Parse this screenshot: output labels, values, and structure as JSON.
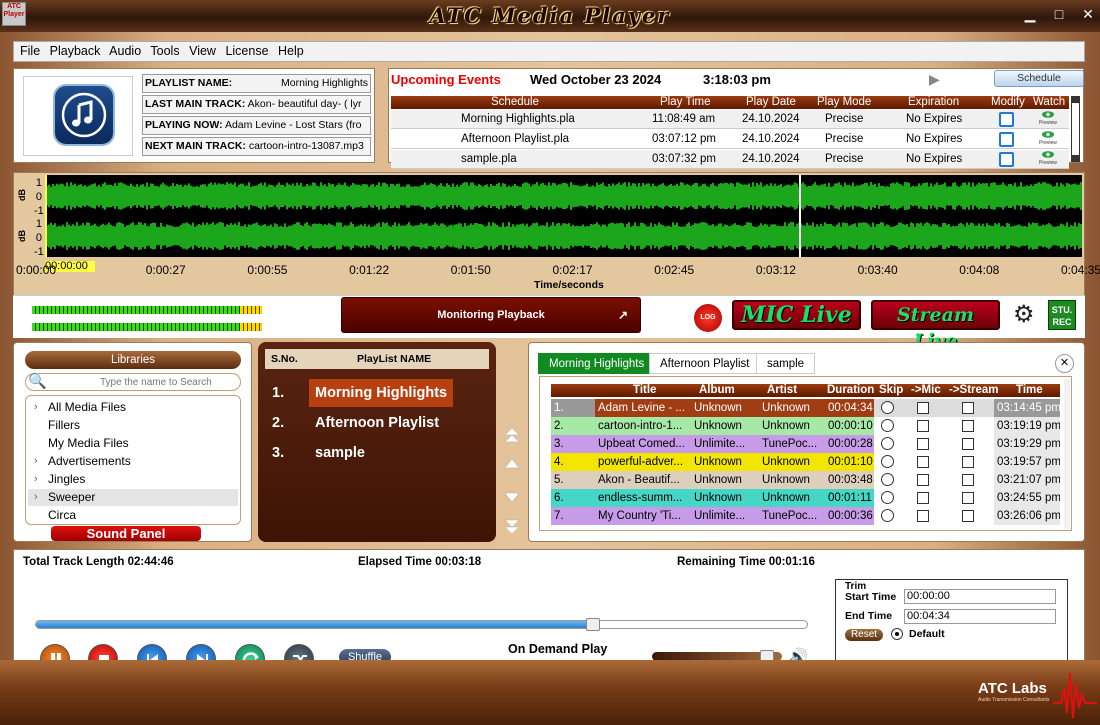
{
  "window": {
    "title": "ATC Media Player",
    "icon_label": "ATC Player"
  },
  "menu": [
    "File",
    "Playback",
    "Audio",
    "Tools",
    "View",
    "License",
    "Help"
  ],
  "now": {
    "playlist_label": "PLAYLIST NAME:",
    "playlist_value": "Morning Highlights",
    "last_label": "LAST MAIN TRACK:",
    "last_value": "Akon- beautiful day- ( lyr",
    "playing_label": "PLAYING NOW:",
    "playing_value": "Adam Levine - Lost Stars (fro",
    "next_label": "NEXT MAIN TRACK:",
    "next_value": "cartoon-intro-13087.mp3"
  },
  "events": {
    "heading": "Upcoming Events",
    "date": "Wed October 23 2024",
    "time": "3:18:03 pm",
    "schedule_button": "Schedule",
    "columns": [
      "Schedule",
      "Play Time",
      "Play Date",
      "Play Mode",
      "Expiration",
      "Modify",
      "Watch"
    ],
    "rows": [
      {
        "name": "Morning Highlights.pla",
        "time": "11:08:49 am",
        "date": "24.10.2024",
        "mode": "Precise",
        "exp": "No Expires"
      },
      {
        "name": "Afternoon Playlist.pla",
        "time": "03:07:12 pm",
        "date": "24.10.2024",
        "mode": "Precise",
        "exp": "No Expires"
      },
      {
        "name": "sample.pla",
        "time": "03:07:32 pm",
        "date": "24.10.2024",
        "mode": "Precise",
        "exp": "No Expires"
      }
    ],
    "preview_label": "Preview"
  },
  "wave": {
    "db_label": "dB",
    "ticks": [
      "0:00:00",
      "0:00:27",
      "0:00:55",
      "0:01:22",
      "0:01:50",
      "0:02:17",
      "0:02:45",
      "0:03:12",
      "0:03:40",
      "0:04:08",
      "0:04:35"
    ],
    "marker": "00:00:00",
    "xlabel": "Time/seconds",
    "y_ticks": [
      "1",
      "0",
      "-1"
    ]
  },
  "controls": {
    "monitoring": "Monitoring Playback",
    "log": "LOG",
    "mic_live": "MIC Live",
    "stream_live": "Stream Live",
    "stu_rec": "STU. REC"
  },
  "library": {
    "heading": "Libraries",
    "search_placeholder": "Type the name to Search",
    "items": [
      "All Media Files",
      "Fillers",
      "My Media Files",
      "Advertisements",
      "Jingles",
      "Sweeper",
      "Circa"
    ],
    "sound_panel": "Sound Panel"
  },
  "playlists": {
    "col_no": "S.No.",
    "col_name": "PlayList NAME",
    "items": [
      {
        "no": "1.",
        "name": "Morning Highlights"
      },
      {
        "no": "2.",
        "name": "Afternoon Playlist"
      },
      {
        "no": "3.",
        "name": "sample"
      }
    ]
  },
  "tracks": {
    "tabs": [
      "Morning Highlights",
      "Afternoon Playlist",
      "sample"
    ],
    "columns": [
      "Title",
      "Album",
      "Artist",
      "Duration",
      "Skip",
      "->Mic",
      "->Stream",
      "Time"
    ],
    "rows": [
      {
        "no": "1.",
        "title": "Adam Levine - ...",
        "album": "Unknown",
        "artist": "Unknown",
        "duration": "00:04:34",
        "time": "03:14:45 pm",
        "color": "#a13d12"
      },
      {
        "no": "2.",
        "title": "cartoon-intro-1...",
        "album": "Unknown",
        "artist": "Unknown",
        "duration": "00:00:10",
        "time": "03:19:19 pm",
        "color": "#a6e8a6"
      },
      {
        "no": "3.",
        "title": "Upbeat Comed...",
        "album": "Unlimite...",
        "artist": "TunePoc...",
        "duration": "00:00:28",
        "time": "03:19:29 pm",
        "color": "#c79be8"
      },
      {
        "no": "4.",
        "title": "powerful-adver...",
        "album": "Unknown",
        "artist": "Unknown",
        "duration": "00:01:10",
        "time": "03:19:57 pm",
        "color": "#f2e600"
      },
      {
        "no": "5.",
        "title": "Akon - Beautif...",
        "album": "Unknown",
        "artist": "Unknown",
        "duration": "00:03:48",
        "time": "03:21:07 pm",
        "color": "#dccfbd"
      },
      {
        "no": "6.",
        "title": "endless-summ...",
        "album": "Unknown",
        "artist": "Unknown",
        "duration": "00:01:11",
        "time": "03:24:55 pm",
        "color": "#45d6c6"
      },
      {
        "no": "7.",
        "title": "My Country 'Ti...",
        "album": "Unlimite...",
        "artist": "TunePoc...",
        "duration": "00:00:36",
        "time": "03:26:06 pm",
        "color": "#c79be8"
      }
    ]
  },
  "transport": {
    "total": "Total Track Length 02:44:46",
    "elapsed": "Elapsed Time 00:03:18",
    "remaining": "Remaining Time 00:01:16",
    "mode": "On Demand Play",
    "shuffle": "Shuffle",
    "progress": 0.72,
    "volume": 0.94
  },
  "trim": {
    "title": "Trim",
    "start_label": "Start Time",
    "start": "00:00:00",
    "end_label": "End Time",
    "end": "00:04:34",
    "reset": "Reset",
    "default": "Default"
  },
  "footer": {
    "brand": "ATC Labs",
    "tagline": "Audio Transmission Consultants"
  }
}
